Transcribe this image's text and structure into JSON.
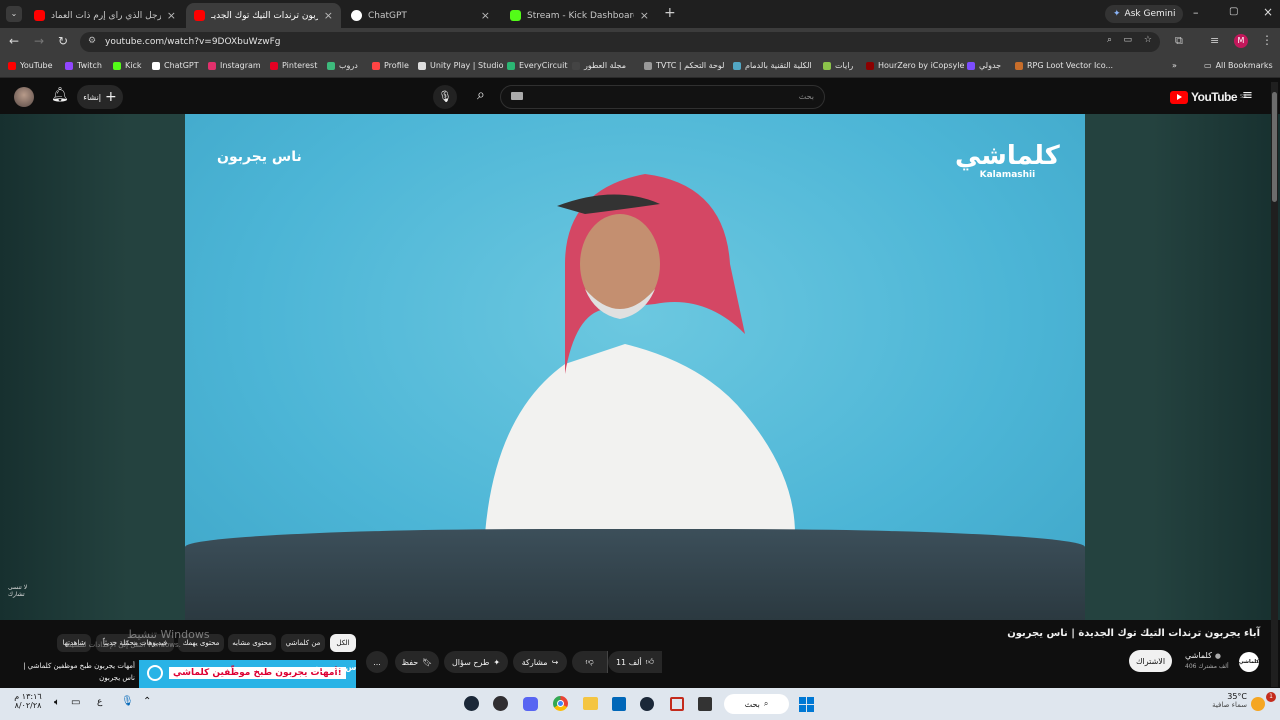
{
  "browser": {
    "tabs": [
      {
        "title": "الرجل الذي رأى إرم ذات العماد ! -",
        "color": "#ff0000"
      },
      {
        "title": "آباء يجربون ترندات التيك توك الجديـ",
        "color": "#ff0000"
      },
      {
        "title": "ChatGPT",
        "color": "#ffffff"
      },
      {
        "title": "Stream - Kick Dashboard",
        "color": "#53fc18"
      }
    ],
    "ask_gemini": "Ask Gemini",
    "url": "youtube.com/watch?v=9DOXbuWzwFg",
    "bookmarks": [
      "YouTube",
      "Twitch",
      "Kick",
      "ChatGPT",
      "Instagram",
      "Pinterest",
      "دروب",
      "Profile",
      "Unity Play | Studio",
      "EveryCircuit",
      "مجلة العطور",
      "TVTC | لوحة التحكم",
      "الكلية التقنية بالدمام",
      "رايات",
      "HourZero by iCopsyle",
      "جدولي",
      "RPG Loot Vector Ico..."
    ],
    "all_bookmarks": "All Bookmarks"
  },
  "youtube": {
    "logo_text": "YouTube",
    "region": "SA",
    "search_placeholder": "بحث",
    "create_label": "إنشاء"
  },
  "video": {
    "overlay_left": "ناس يجربون",
    "brand_ar": "كلماشي",
    "brand_en": "Kalamashii",
    "corner_text": "لا تنسى تشارك"
  },
  "info": {
    "title": "آباء يجربون ترندات التيك توك الجديدة | ناس يجربون",
    "channel": "كلماشي",
    "subscribers": "406 ألف مشترك",
    "subscribe": "الاشتراك",
    "likes": "11 ألف",
    "share": "مشاركة",
    "ask": "طرح سؤال",
    "save": "حفظ",
    "more": "..."
  },
  "chips": [
    "الكل",
    "من كلماشي",
    "محتوى مشابه",
    "محتوى يهمك",
    "فيديوهات محمّلة حديثاً",
    "شاهدتها"
  ],
  "recommend": {
    "thumb_text": "أمهات يجربون طبخ موظّفين كلماشي!",
    "thumb_logo": "ناس يجربون",
    "title": "أمهات يجربون طبخ موظفين كلماشي | ناس يجربون"
  },
  "watermark": {
    "line1": "تنشيط Windows",
    "line2": "انتقل إلى الإعدادات لتنشيط Windows."
  },
  "taskbar": {
    "weather_temp": "35°C",
    "weather_desc": "سماء صافية",
    "weather_badge": "1",
    "search": "بحث",
    "time": "١٣:١٦ م",
    "date": "٨/٠٢/٢٨",
    "lang": "ع"
  }
}
